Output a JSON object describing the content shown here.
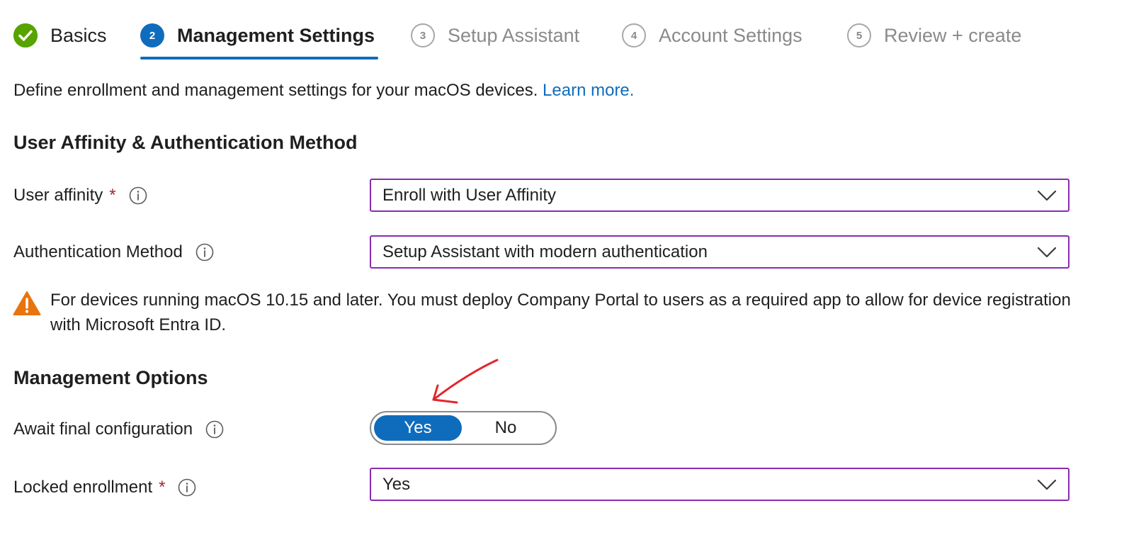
{
  "steps": [
    {
      "number": "",
      "label": "Basics",
      "status": "done"
    },
    {
      "number": "2",
      "label": "Management Settings",
      "status": "active"
    },
    {
      "number": "3",
      "label": "Setup Assistant",
      "status": "inactive"
    },
    {
      "number": "4",
      "label": "Account Settings",
      "status": "inactive"
    },
    {
      "number": "5",
      "label": "Review + create",
      "status": "inactive"
    }
  ],
  "intro": {
    "text": "Define enrollment and management settings for your macOS devices.",
    "link": "Learn more."
  },
  "section_auth": {
    "heading": "User Affinity & Authentication Method",
    "user_affinity": {
      "label": "User affinity",
      "required": "*",
      "value": "Enroll with User Affinity"
    },
    "auth_method": {
      "label": "Authentication Method",
      "value": "Setup Assistant with modern authentication"
    },
    "warning": "For devices running macOS 10.15 and later. You must deploy Company Portal to users as a required app to allow for device registration with Microsoft Entra ID."
  },
  "section_management": {
    "heading": "Management Options",
    "await_final": {
      "label": "Await final configuration",
      "options": [
        "Yes",
        "No"
      ],
      "selected": "Yes"
    },
    "locked_enrollment": {
      "label": "Locked enrollment",
      "required": "*",
      "value": "Yes"
    }
  },
  "colors": {
    "accent": "#0f6cbd",
    "done": "#57a300",
    "dropdown_border": "#8a2bb0",
    "required": "#a4262c",
    "warning": "#e9730c",
    "annotation": "#e3262b"
  }
}
